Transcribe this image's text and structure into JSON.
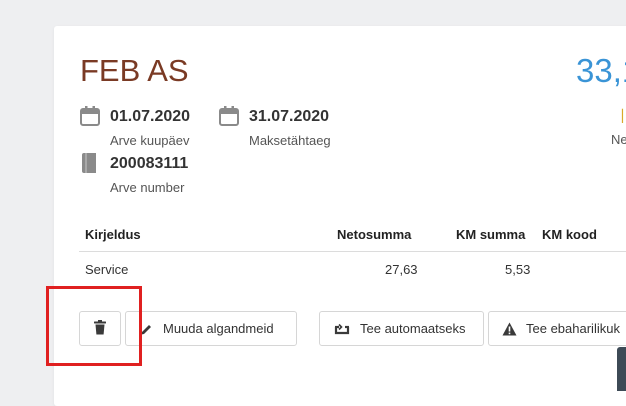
{
  "header": {
    "vendor_name": "FEB AS",
    "amount_partial": "33,1",
    "side_label_partial": "Ne"
  },
  "meta": {
    "invoice_date": {
      "value": "01.07.2020",
      "label": "Arve kuupäev"
    },
    "due_date": {
      "value": "31.07.2020",
      "label": "Maksetähtaeg"
    },
    "invoice_number": {
      "value": "200083111",
      "label": "Arve number"
    }
  },
  "table": {
    "headers": {
      "description": "Kirjeldus",
      "net": "Netosumma",
      "vat": "KM summa",
      "vat_code": "KM kood"
    },
    "rows": [
      {
        "description": "Service",
        "net": "27,63",
        "vat": "5,53",
        "vat_code": ""
      }
    ]
  },
  "actions": {
    "delete_icon": "trash-icon",
    "edit_label": "Muuda algandmeid",
    "automate_label": "Tee automaatseks",
    "unusual_label": "Tee ebaharilikuk"
  },
  "colors": {
    "vendor": "#7a3a24",
    "amount": "#3a94d6",
    "highlight": "#e02020"
  }
}
